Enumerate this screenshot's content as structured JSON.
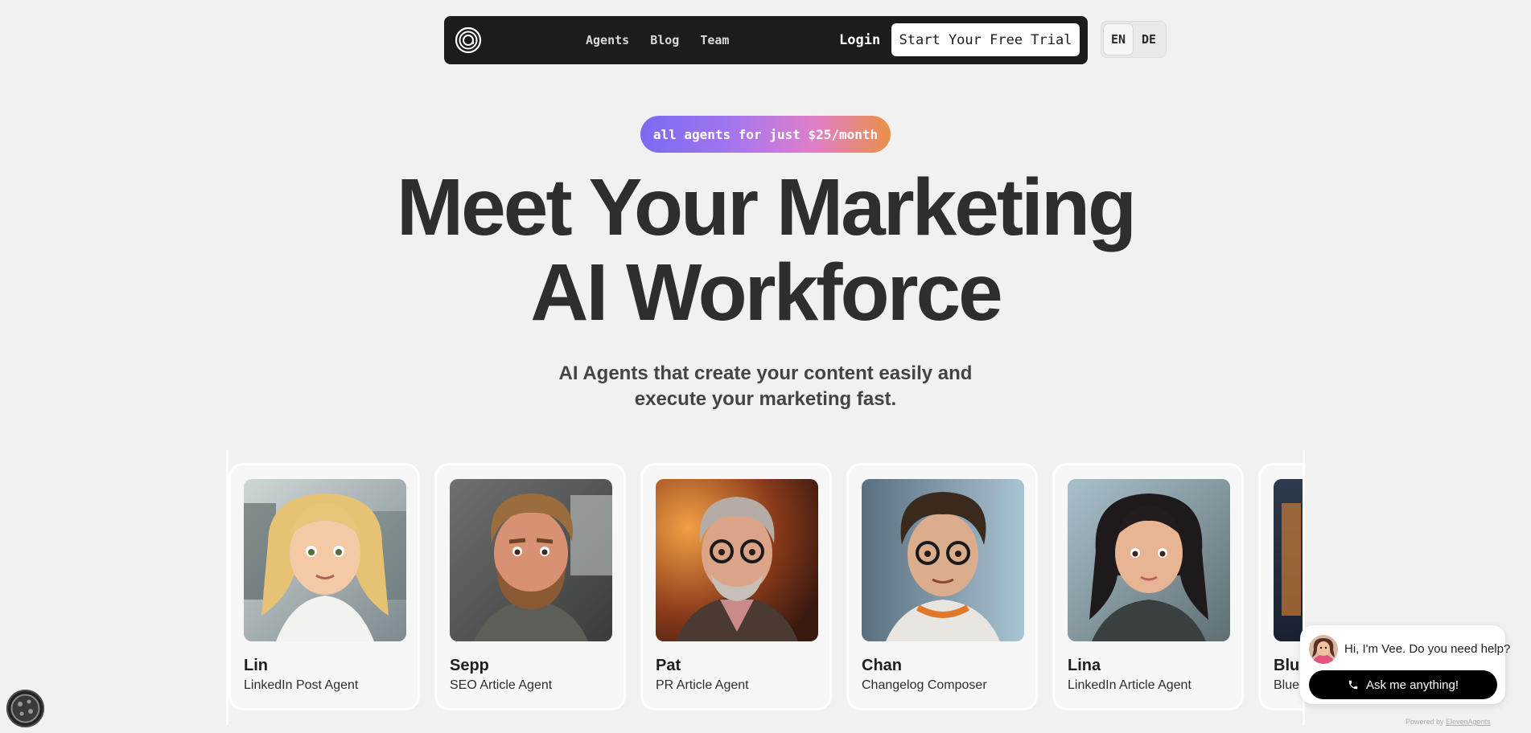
{
  "nav": {
    "links": [
      "Agents",
      "Blog",
      "Team"
    ],
    "login": "Login",
    "cta": "Start Your Free Trial",
    "logo_icon": "at-sign-logo-icon"
  },
  "lang": {
    "options": [
      "EN",
      "DE"
    ],
    "active": "EN"
  },
  "hero": {
    "badge": "all agents for just $25/month",
    "title_line1": "Meet Your Marketing",
    "title_line2": "AI Workforce",
    "sub_line1": "AI Agents that create your content easily and",
    "sub_line2": "execute your marketing fast."
  },
  "agents": [
    {
      "name": "Lin",
      "role": "LinkedIn Post Agent"
    },
    {
      "name": "Sepp",
      "role": "SEO Article Agent"
    },
    {
      "name": "Pat",
      "role": "PR Article Agent"
    },
    {
      "name": "Chan",
      "role": "Changelog Composer"
    },
    {
      "name": "Lina",
      "role": "LinkedIn Article Agent"
    },
    {
      "name": "Blu",
      "role": "Blue"
    }
  ],
  "chat": {
    "message": "Hi, I'm Vee. Do you need help?",
    "button": "Ask me anything!",
    "powered_prefix": "Powered by ",
    "powered_brand": "ElevenAgents"
  },
  "colors": {
    "nav_bg": "#1c1c1c",
    "page_bg": "#f1f1f1",
    "badge_gradient": [
      "#7a6af2",
      "#e07fc8",
      "#ea9147"
    ]
  }
}
